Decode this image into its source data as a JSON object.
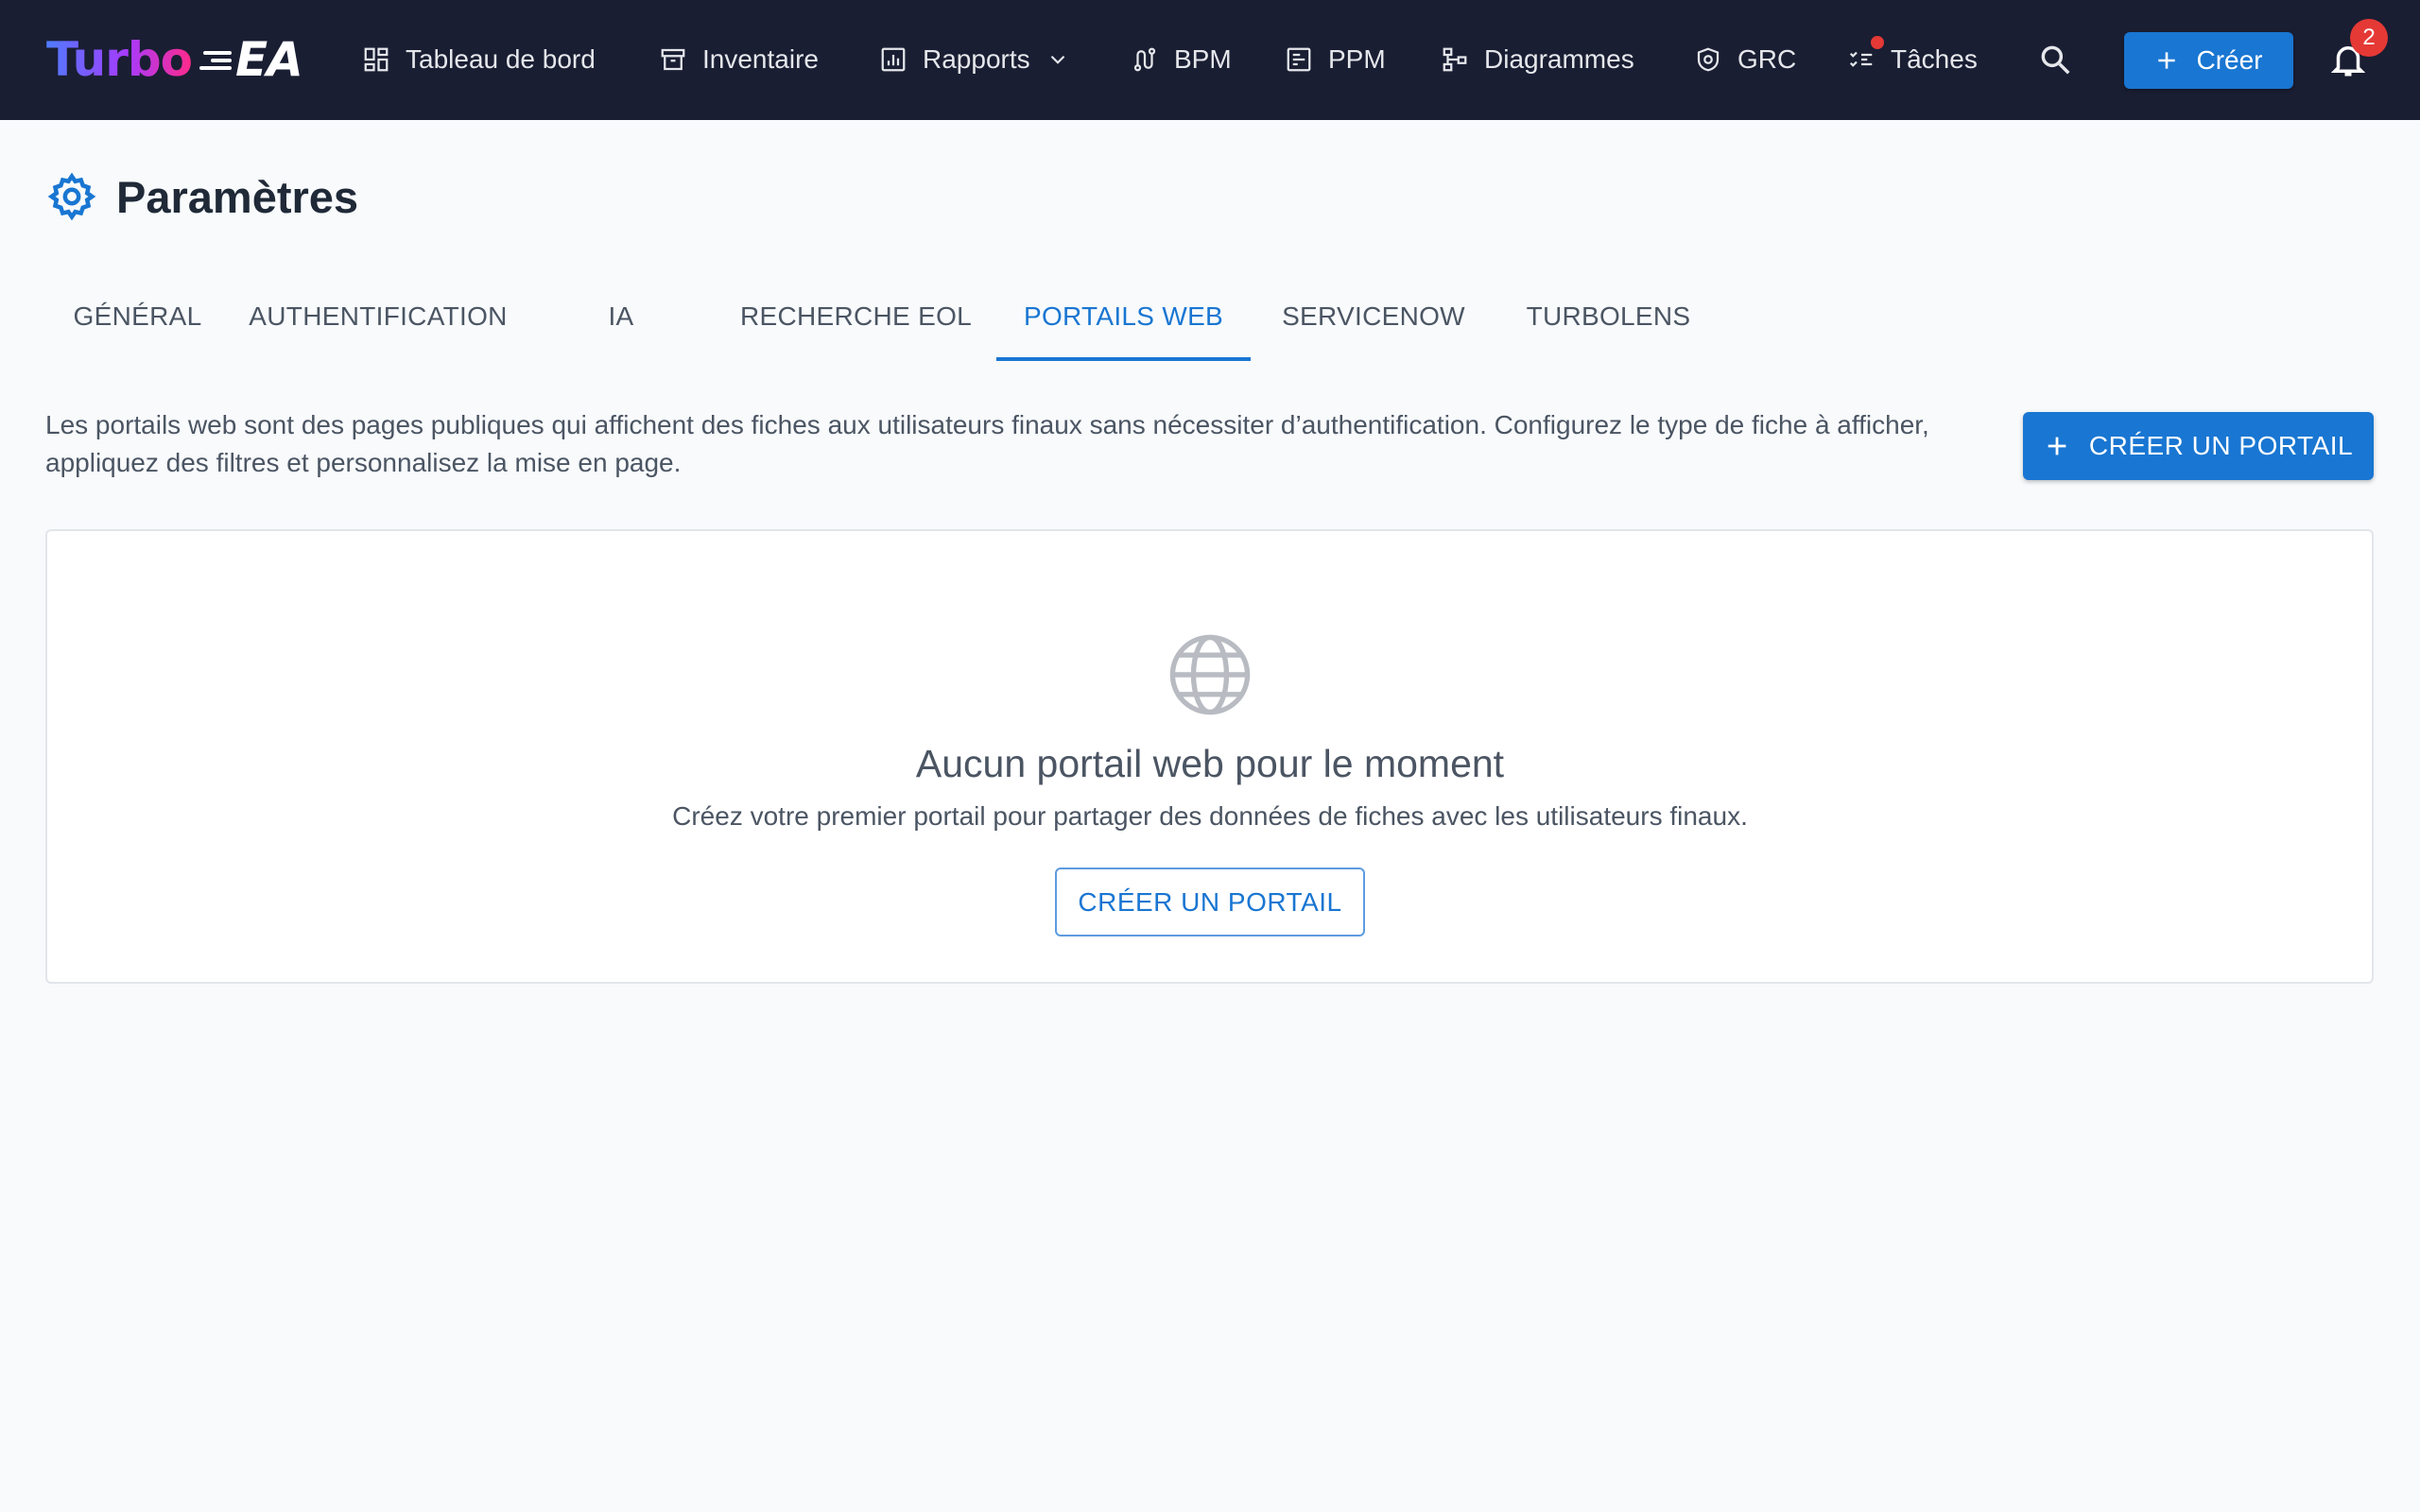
{
  "app": {
    "logo_turbo": "Turbo",
    "logo_ea": "EA"
  },
  "nav": {
    "items": [
      {
        "label": "Tableau de bord",
        "icon": "dashboard-icon"
      },
      {
        "label": "Inventaire",
        "icon": "archive-icon"
      },
      {
        "label": "Rapports",
        "icon": "report-icon"
      },
      {
        "label": "BPM",
        "icon": "process-icon"
      },
      {
        "label": "PPM",
        "icon": "project-icon"
      },
      {
        "label": "Diagrammes",
        "icon": "diagram-icon"
      },
      {
        "label": "GRC",
        "icon": "shield-icon"
      },
      {
        "label": "Tâches",
        "icon": "tasks-icon"
      }
    ],
    "create_label": "Créer",
    "notification_count": "2"
  },
  "page": {
    "title": "Paramètres"
  },
  "tabs": [
    {
      "label": "Général"
    },
    {
      "label": "Authentification"
    },
    {
      "label": "IA"
    },
    {
      "label": "Recherche EOL"
    },
    {
      "label": "Portails web"
    },
    {
      "label": "ServiceNow"
    },
    {
      "label": "TurboLens"
    }
  ],
  "active_tab": "Portails web",
  "portals": {
    "description": "Les portails web sont des pages publiques qui affichent des fiches aux utilisateurs finaux sans nécessiter d’authentification. Configurez le type de fiche à afficher, appliquez des filtres et personnalisez la mise en page.",
    "create_button": "CRÉER UN PORTAIL",
    "empty_title": "Aucun portail web pour le moment",
    "empty_text": "Créez votre premier portail pour partager des données de fiches avec les utilisateurs finaux.",
    "empty_button": "CRÉER UN PORTAIL"
  },
  "colors": {
    "nav_bg": "#1a1e33",
    "accent": "#1976d2",
    "badge": "#e53935",
    "page_bg": "#f8fafc"
  }
}
